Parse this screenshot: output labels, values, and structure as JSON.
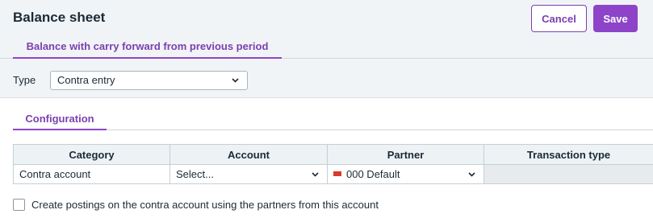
{
  "header": {
    "title": "Balance sheet",
    "cancel_label": "Cancel",
    "save_label": "Save"
  },
  "tabs": [
    {
      "label": "Balance with carry forward from previous period",
      "active": true
    }
  ],
  "type_field": {
    "label": "Type",
    "value": "Contra entry"
  },
  "section_tab": {
    "label": "Configuration"
  },
  "table": {
    "columns": [
      "Category",
      "Account",
      "Partner",
      "Transaction type"
    ],
    "rows": [
      {
        "category": "Contra account",
        "account": "Select...",
        "partner": "000 Default",
        "transaction_type": ""
      }
    ]
  },
  "checkbox": {
    "label": "Create postings on the contra account using the partners from this account",
    "checked": false
  },
  "colors": {
    "accent": "#8e44c8",
    "accent_text": "#7b3fb0",
    "header_bg": "#f1f4f6",
    "flag": "#d93a2b"
  },
  "icons": [
    "chevron-down-icon",
    "flag-icon"
  ]
}
